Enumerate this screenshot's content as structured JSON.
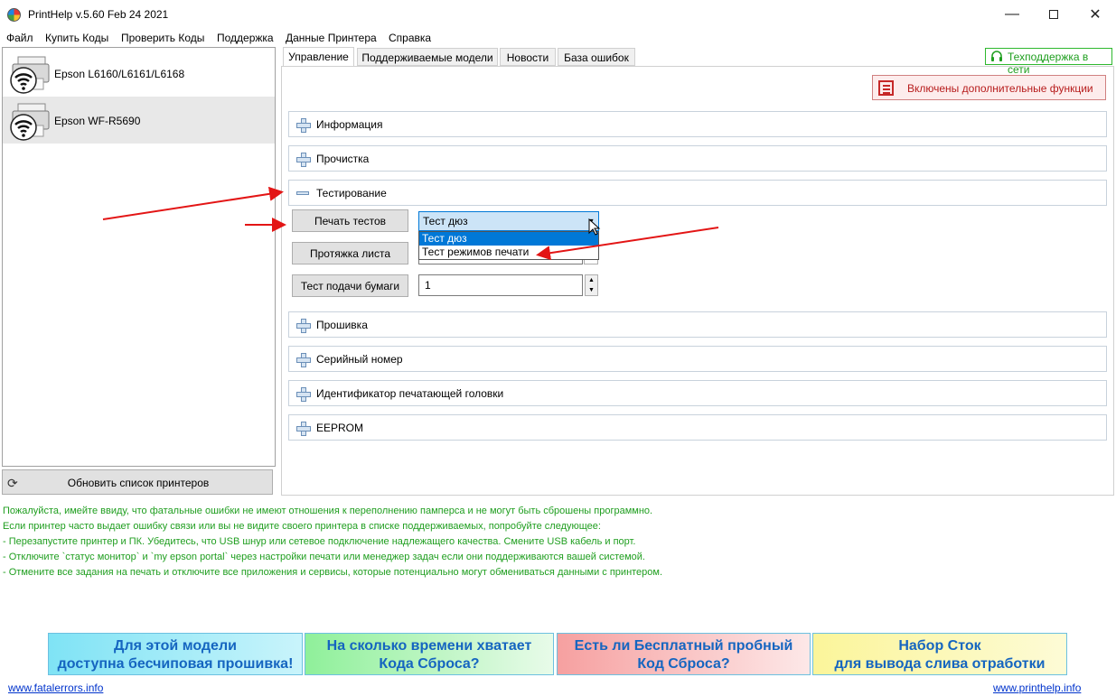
{
  "window": {
    "title": "PrintHelp v.5.60 Feb 24 2021",
    "minimize": "—",
    "close": "✕"
  },
  "menu": [
    "Файл",
    "Купить Коды",
    "Проверить Коды",
    "Поддержка",
    "Данные Принтера",
    "Справка"
  ],
  "printers": [
    {
      "name": "Epson L6160/L6161/L6168"
    },
    {
      "name": "Epson WF-R5690"
    }
  ],
  "refresh_label": "Обновить список принтеров",
  "tabs": [
    "Управление",
    "Поддерживаемые модели",
    "Новости",
    "База ошибок"
  ],
  "support_badge": "Техподдержка в сети",
  "extra_button": "Включены дополнительные функции",
  "sections": {
    "info": "Информация",
    "cleaning": "Прочистка",
    "testing": "Тестирование",
    "firmware": "Прошивка",
    "serial": "Серийный номер",
    "head_id": "Идентификатор печатающей головки",
    "eeprom": "EEPROM"
  },
  "testing": {
    "print_tests_button": "Печать тестов",
    "sheet_feed_button": "Протяжка листа",
    "paper_feed_test_button": "Тест подачи бумаги",
    "test_select": {
      "selected": "Тест дюз",
      "options": [
        "Тест дюз",
        "Тест режимов печати"
      ]
    },
    "feed_count": "1"
  },
  "info_text": [
    "Пожалуйста, имейте ввиду, что фатальные ошибки не имеют отношения к переполнению памперса и не могут быть сброшены программно.",
    "Если принтер часто выдает ошибку связи или вы не видите своего принтера в списке поддерживаемых, попробуйте следующее:",
    "- Перезапустите принтер и ПК. Убедитесь, что USB шнур или сетевое подключение надлежащего качества. Смените USB кабель и порт.",
    "- Отключите `статус монитор` и `my epson portal` через настройки печати или менеджер задач если они поддерживаются вашей системой.",
    "- Отмените все задания на печать и отключите все приложения и сервисы, которые потенциально могут обмениваться данными с принтером."
  ],
  "promos": [
    {
      "line1": "Для этой модели",
      "line2": "доступна бесчиповая прошивка!"
    },
    {
      "line1": "На сколько времени хватает",
      "line2": "Кода Сброса?"
    },
    {
      "line1": "Есть ли Бесплатный пробный",
      "line2": "Код Сброса?"
    },
    {
      "line1": "Набор Сток",
      "line2": "для вывода слива отработки"
    }
  ],
  "links": {
    "left": "www.fatalerrors.info",
    "right": "www.printhelp.info"
  },
  "colors": {
    "arrow": "#e31515",
    "info_text": "#1f9e1f",
    "selection": "#0078d7",
    "support": "#1e9e1e"
  }
}
